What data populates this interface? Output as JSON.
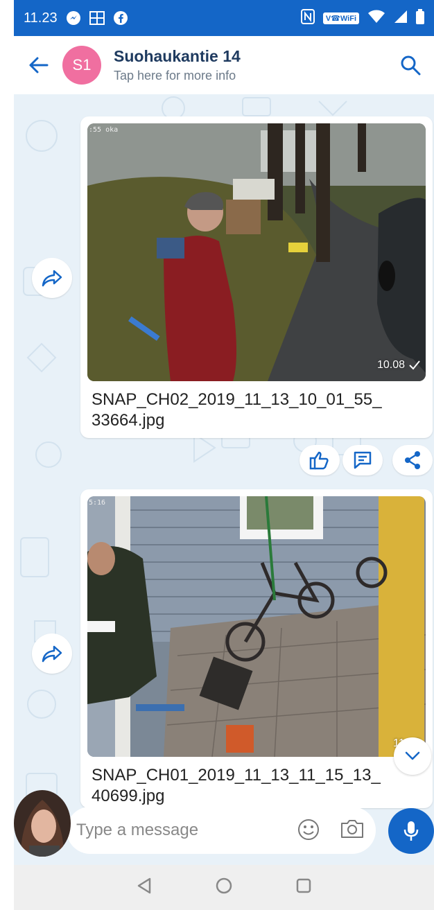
{
  "status_bar": {
    "time": "11.23",
    "wifi_label": "V☎WiFi",
    "icons": [
      "messenger-icon",
      "gallery-icon",
      "facebook-icon",
      "nfc-icon",
      "wifi-icon",
      "signal-icon",
      "battery-icon"
    ]
  },
  "header": {
    "avatar_initials": "S1",
    "title": "Suohaukantie 14",
    "subtitle": "Tap here for more info"
  },
  "messages": [
    {
      "caption_line1": "SNAP_CH02_2019_11_13_10_01_55_",
      "caption_line2": "33664.jpg",
      "time": "10.08",
      "status": "sent",
      "overlay_corner": ":55 oka"
    },
    {
      "caption_line1": "SNAP_CH01_2019_11_13_11_15_13_",
      "caption_line2": "40699.jpg",
      "time": "11.17",
      "overlay_corner": "5:16"
    }
  ],
  "message_actions": [
    "like-icon",
    "comment-icon",
    "share-icon"
  ],
  "composer": {
    "placeholder": "Type a message"
  },
  "colors": {
    "accent": "#1466c7",
    "avatar": "#f06fa0",
    "chat_bg": "#e8f1f8"
  }
}
